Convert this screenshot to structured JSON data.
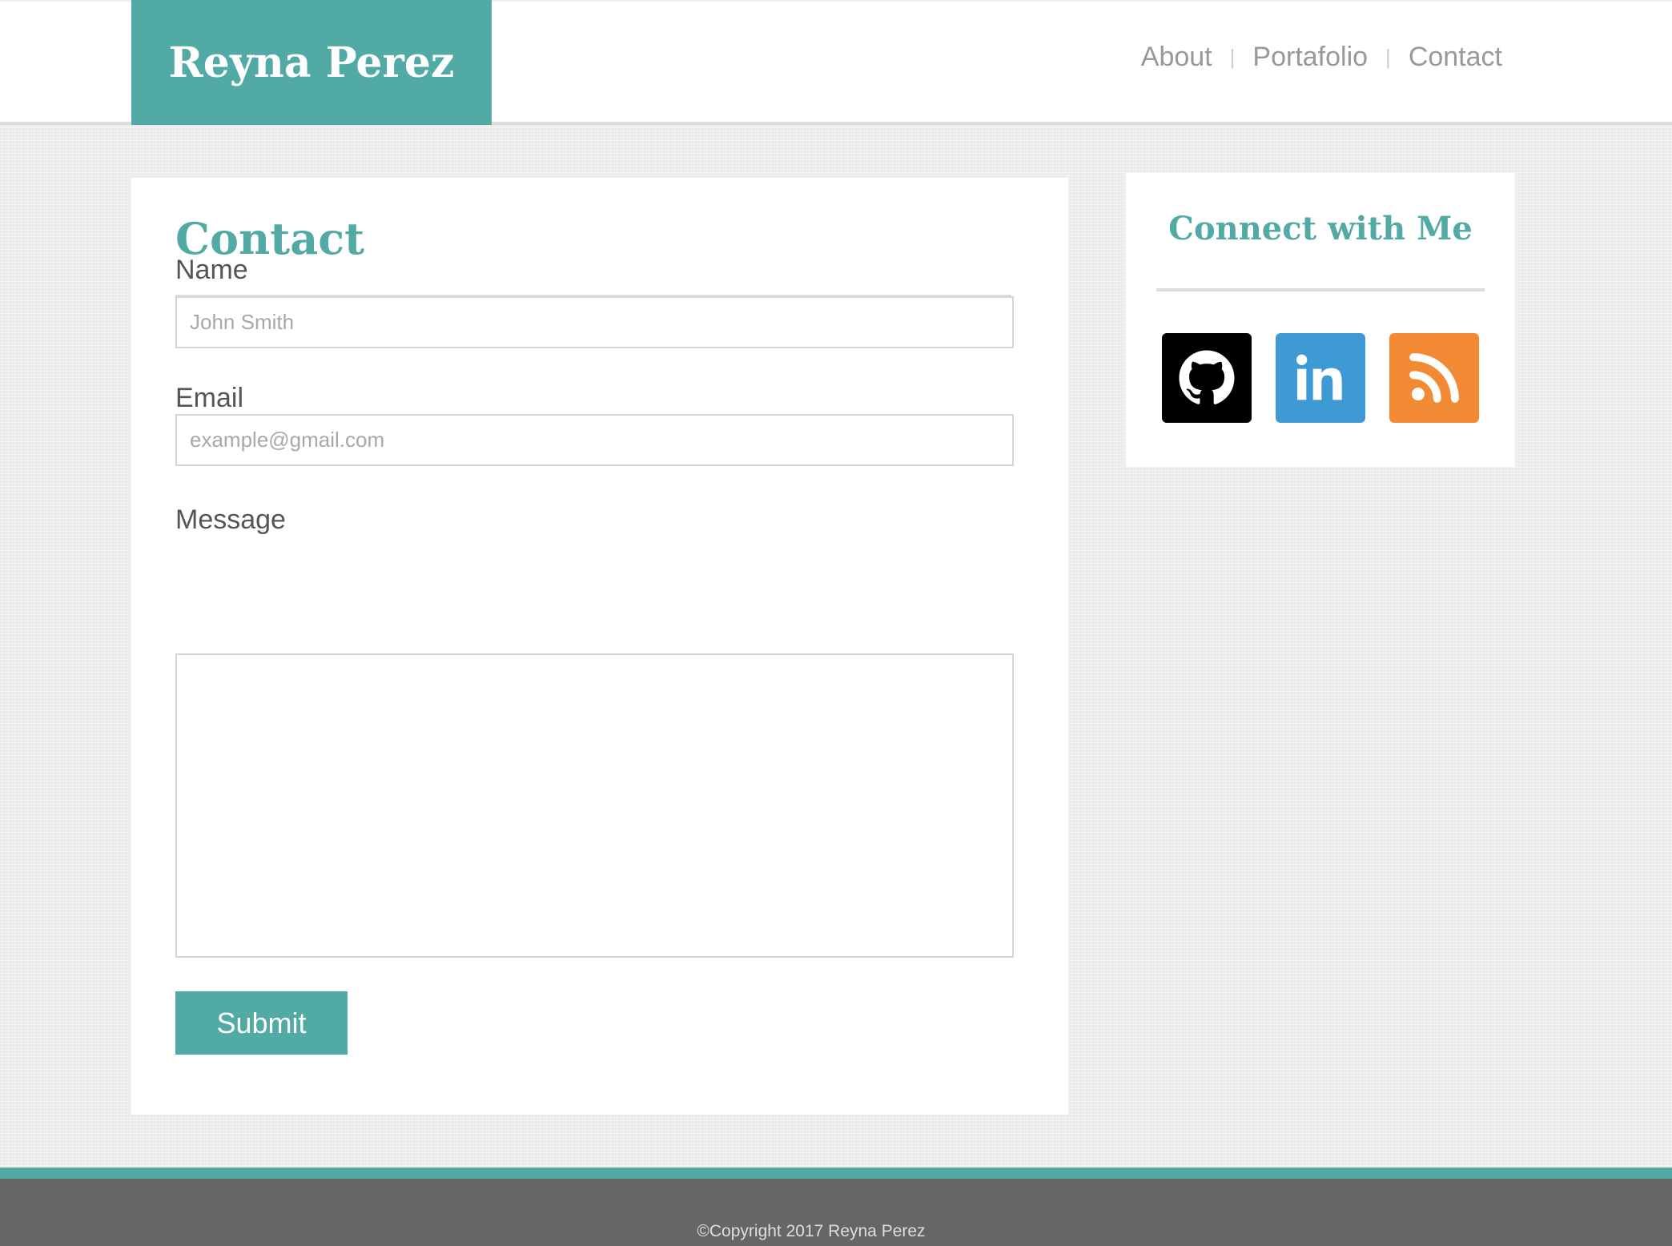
{
  "header": {
    "logo": "Reyna Perez",
    "nav": [
      {
        "label": "About"
      },
      {
        "label": "Portafolio"
      },
      {
        "label": "Contact"
      }
    ],
    "separator": "|"
  },
  "contact": {
    "title": "Contact",
    "name_label": "Name",
    "name_placeholder": "John Smith",
    "email_label": "Email",
    "email_placeholder": "example@gmail.com",
    "message_label": "Message",
    "submit_label": "Submit"
  },
  "sidebar": {
    "title": "Connect with Me",
    "links": [
      {
        "icon": "github-icon",
        "color": "#000000"
      },
      {
        "icon": "linkedin-icon",
        "color": "#3e9ad5"
      },
      {
        "icon": "rss-icon",
        "color": "#f28a33"
      }
    ]
  },
  "footer": {
    "copyright": "©Copyright 2017 Reyna Perez"
  },
  "colors": {
    "accent": "#52aaa5",
    "footer": "#666666"
  }
}
